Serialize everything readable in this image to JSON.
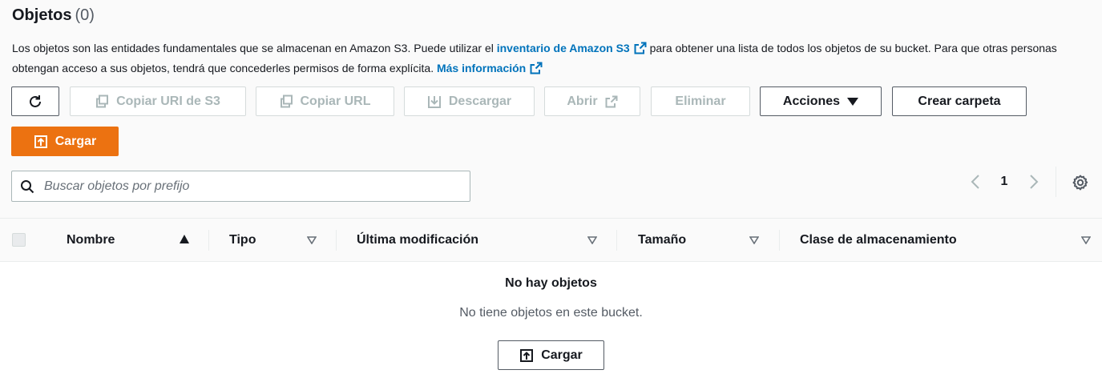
{
  "header": {
    "title": "Objetos",
    "count": "(0)"
  },
  "description": {
    "part1": "Los objetos son las entidades fundamentales que se almacenan en Amazon S3. Puede utilizar el ",
    "link1": "inventario de Amazon S3",
    "part2": " para obtener una lista de todos los objetos de su bucket. Para que otras personas obtengan acceso a sus objetos, tendrá que concederles permisos de forma explícita. ",
    "link2": "Más información"
  },
  "toolbar": {
    "refresh_icon": "refresh-icon",
    "copy_uri": "Copiar URI de S3",
    "copy_url": "Copiar URL",
    "download": "Descargar",
    "open": "Abrir",
    "delete": "Eliminar",
    "actions": "Acciones",
    "create_folder": "Crear carpeta",
    "upload": "Cargar"
  },
  "search": {
    "placeholder": "Buscar objetos por prefijo",
    "value": ""
  },
  "pagination": {
    "current_page": "1"
  },
  "table": {
    "columns": [
      {
        "label": "Nombre",
        "sort": "ascending"
      },
      {
        "label": "Tipo",
        "sort": "none"
      },
      {
        "label": "Última modificación",
        "sort": "none"
      },
      {
        "label": "Tamaño",
        "sort": "none"
      },
      {
        "label": "Clase de almacenamiento",
        "sort": "none"
      }
    ],
    "rows": []
  },
  "empty_state": {
    "title": "No hay objetos",
    "description": "No tiene objetos en este bucket.",
    "button": "Cargar"
  },
  "colors": {
    "primary": "#ec7211",
    "link": "#0073bb",
    "disabled_text": "#aab7b8",
    "text": "#16191f"
  }
}
